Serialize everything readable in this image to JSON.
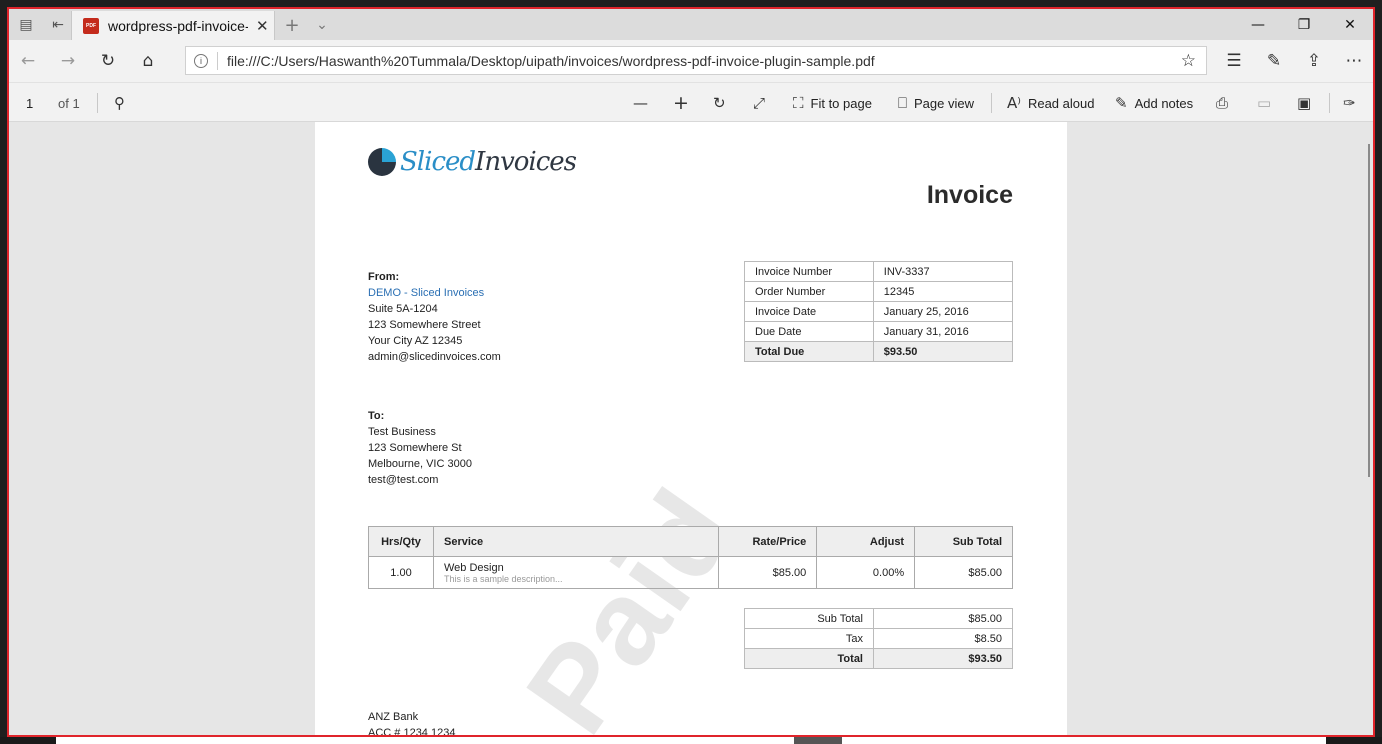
{
  "tabbar": {
    "tab_title": "wordpress-pdf-invoice-",
    "tab_icon_label": "PDF"
  },
  "address": {
    "url": "file:///C:/Users/Haswanth%20Tummala/Desktop/uipath/invoices/wordpress-pdf-invoice-plugin-sample.pdf"
  },
  "pdf_toolbar": {
    "page_number": "1",
    "page_total": "of 1",
    "fit_to_page": "Fit to page",
    "page_view": "Page view",
    "read_aloud": "Read aloud",
    "add_notes": "Add notes"
  },
  "invoice": {
    "logo_part1": "Sliced",
    "logo_part2": "Invoices",
    "title": "Invoice",
    "watermark": "Paid",
    "from": {
      "label": "From:",
      "company": "DEMO - Sliced Invoices",
      "line1": "Suite 5A-1204",
      "line2": "123 Somewhere Street",
      "line3": "Your City AZ 12345",
      "email": "admin@slicedinvoices.com"
    },
    "to": {
      "label": "To:",
      "name": "Test Business",
      "line1": "123 Somewhere St",
      "line2": "Melbourne, VIC 3000",
      "email": "test@test.com"
    },
    "meta": [
      {
        "label": "Invoice Number",
        "value": "INV-3337"
      },
      {
        "label": "Order Number",
        "value": "12345"
      },
      {
        "label": "Invoice Date",
        "value": "January 25, 2016"
      },
      {
        "label": "Due Date",
        "value": "January 31, 2016"
      },
      {
        "label": "Total Due",
        "value": "$93.50"
      }
    ],
    "items_headers": {
      "qty": "Hrs/Qty",
      "service": "Service",
      "rate": "Rate/Price",
      "adjust": "Adjust",
      "subtotal": "Sub Total"
    },
    "items": [
      {
        "qty": "1.00",
        "service": "Web Design",
        "description": "This is a sample description...",
        "rate": "$85.00",
        "adjust": "0.00%",
        "subtotal": "$85.00"
      }
    ],
    "totals": [
      {
        "label": "Sub Total",
        "value": "$85.00"
      },
      {
        "label": "Tax",
        "value": "$8.50"
      },
      {
        "label": "Total",
        "value": "$93.50"
      }
    ],
    "bank": {
      "name": "ANZ Bank",
      "account": "ACC # 1234 1234"
    }
  }
}
